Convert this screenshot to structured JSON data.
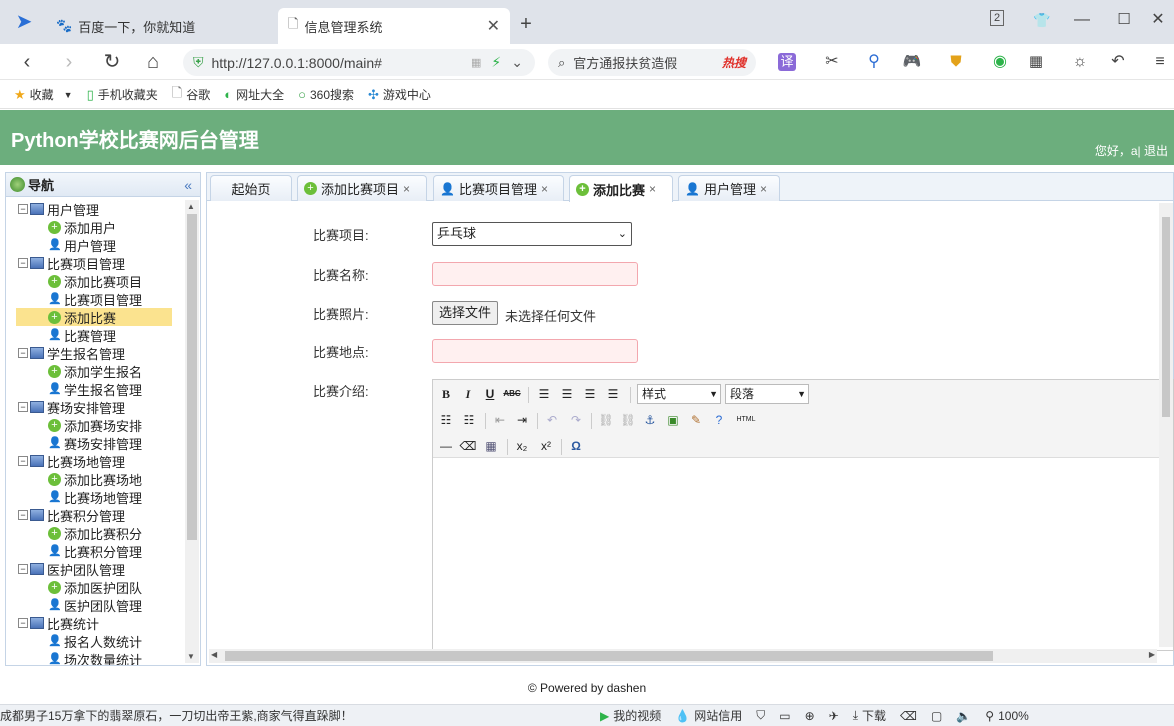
{
  "browser": {
    "tabs": [
      {
        "label": "百度一下，你就知道"
      },
      {
        "label": "信息管理系统"
      }
    ],
    "new_tab": "+",
    "window_badge": "2",
    "url": "http://127.0.0.1:8000/main#",
    "search_text": "官方通报扶贫造假",
    "hot_label": "热搜",
    "bookmarks": [
      "收藏",
      "手机收藏夹",
      "谷歌",
      "网址大全",
      "360搜索",
      "游戏中心"
    ]
  },
  "app": {
    "title": "Python学校比赛网后台管理",
    "greeting": "您好，a| 退出"
  },
  "sidebar": {
    "title": "导航",
    "collapse": "«",
    "groups": [
      {
        "label": "用户管理",
        "items": [
          "添加用户",
          "用户管理"
        ]
      },
      {
        "label": "比赛项目管理",
        "items": [
          "添加比赛项目",
          "比赛项目管理",
          "添加比赛",
          "比赛管理"
        ]
      },
      {
        "label": "学生报名管理",
        "items": [
          "添加学生报名",
          "学生报名管理"
        ]
      },
      {
        "label": "赛场安排管理",
        "items": [
          "添加赛场安排",
          "赛场安排管理"
        ]
      },
      {
        "label": "比赛场地管理",
        "items": [
          "添加比赛场地",
          "比赛场地管理"
        ]
      },
      {
        "label": "比赛积分管理",
        "items": [
          "添加比赛积分",
          "比赛积分管理"
        ]
      },
      {
        "label": "医护团队管理",
        "items": [
          "添加医护团队",
          "医护团队管理"
        ]
      },
      {
        "label": "比赛统计",
        "items": [
          "报名人数统计",
          "场次数量统计"
        ]
      }
    ],
    "selected": "添加比赛"
  },
  "tabs": [
    {
      "label": "起始页"
    },
    {
      "label": "添加比赛项目"
    },
    {
      "label": "比赛项目管理"
    },
    {
      "label": "添加比赛"
    },
    {
      "label": "用户管理"
    }
  ],
  "active_tab": "添加比赛",
  "form": {
    "project_label": "比赛项目:",
    "project_value": "乒乓球",
    "name_label": "比赛名称:",
    "photo_label": "比赛照片:",
    "file_button": "选择文件",
    "file_status": "未选择任何文件",
    "place_label": "比赛地点:",
    "intro_label": "比赛介绍:"
  },
  "editor": {
    "style_combo": "样式",
    "para_combo": "段落",
    "html_label": "HTML"
  },
  "footer": "© Powered by dashen",
  "statusbar": {
    "news": "成都男子15万拿下的翡翠原石，一刀切出帝王紫,商家气得直跺脚！",
    "items": [
      "我的视频",
      "网站信用",
      "下载"
    ],
    "zoom": "100%"
  },
  "colors": {
    "header_green": "#6cae7d",
    "selected_row": "#fbe38f",
    "input_error_border": "#f3a7ae",
    "input_error_bg": "#fff0f0"
  }
}
